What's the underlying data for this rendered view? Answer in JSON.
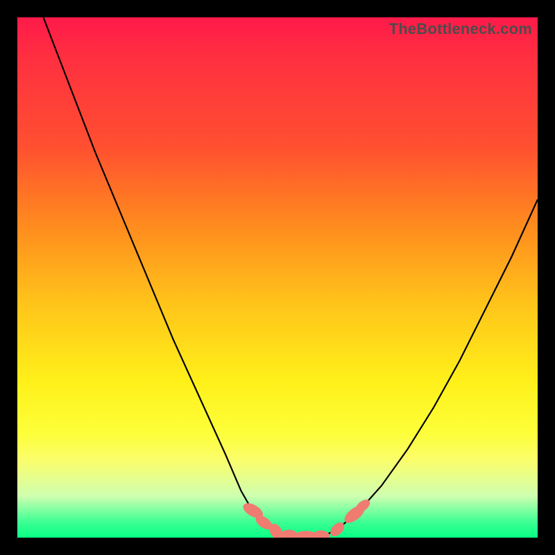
{
  "watermark": "TheBottleneck.com",
  "colors": {
    "frame": "#000000",
    "curve": "#000000",
    "marker": "#ef7b71",
    "watermark_text": "#4c4c4c"
  },
  "chart_data": {
    "type": "line",
    "title": "",
    "xlabel": "",
    "ylabel": "",
    "xlim": [
      0,
      100
    ],
    "ylim": [
      0,
      100
    ],
    "series": [
      {
        "name": "left-curve",
        "x": [
          5,
          10,
          15,
          20,
          25,
          30,
          35,
          40,
          43,
          45,
          47,
          50,
          53
        ],
        "y": [
          100,
          87,
          74,
          62,
          50,
          38,
          27,
          16,
          9,
          5.5,
          3,
          1,
          0
        ]
      },
      {
        "name": "valley-floor",
        "x": [
          50,
          53,
          56,
          59
        ],
        "y": [
          1,
          0,
          0,
          0.3
        ]
      },
      {
        "name": "right-curve",
        "x": [
          59,
          62,
          66,
          70,
          75,
          80,
          85,
          90,
          95,
          100
        ],
        "y": [
          0.3,
          2,
          5.5,
          10,
          17,
          25,
          34,
          44,
          54,
          65
        ]
      }
    ],
    "markers": [
      {
        "x": 45.3,
        "y": 5.2,
        "rx": 1.1,
        "ry": 2.1,
        "angle": -60
      },
      {
        "x": 47.4,
        "y": 2.9,
        "rx": 1.0,
        "ry": 1.8,
        "angle": -55
      },
      {
        "x": 49.7,
        "y": 1.2,
        "rx": 1.1,
        "ry": 1.6,
        "angle": -30
      },
      {
        "x": 52.0,
        "y": 0.4,
        "rx": 1.8,
        "ry": 1.1,
        "angle": -8
      },
      {
        "x": 55.5,
        "y": 0.2,
        "rx": 2.4,
        "ry": 1.1,
        "angle": 0
      },
      {
        "x": 58.5,
        "y": 0.3,
        "rx": 1.6,
        "ry": 1.1,
        "angle": 8
      },
      {
        "x": 61.5,
        "y": 1.6,
        "rx": 1.0,
        "ry": 1.6,
        "angle": 45
      },
      {
        "x": 64.8,
        "y": 4.5,
        "rx": 1.1,
        "ry": 2.3,
        "angle": 52
      },
      {
        "x": 66.4,
        "y": 6.1,
        "rx": 0.9,
        "ry": 1.6,
        "angle": 52
      }
    ]
  }
}
